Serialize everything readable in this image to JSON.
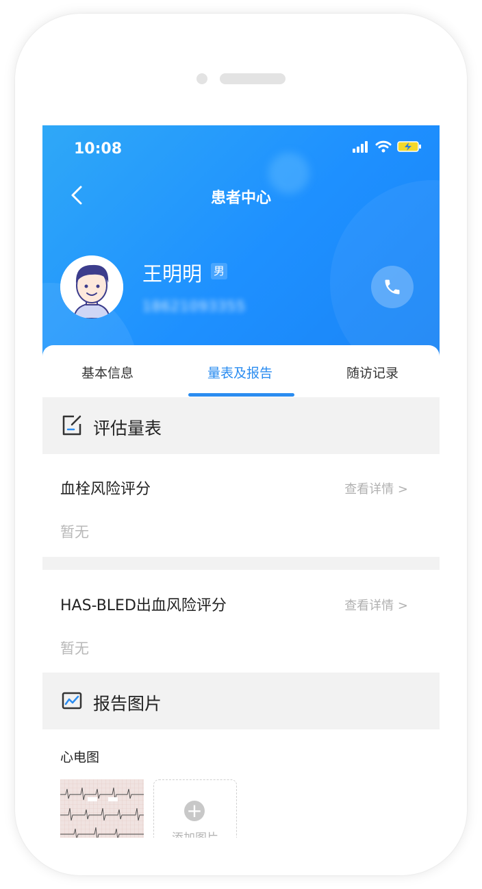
{
  "status": {
    "time": "10:08"
  },
  "header": {
    "title": "患者中心"
  },
  "patient": {
    "name": "王明明",
    "gender": "男",
    "phone": "18621093355"
  },
  "tabs": [
    {
      "label": "基本信息",
      "active": false
    },
    {
      "label": "量表及报告",
      "active": true
    },
    {
      "label": "随访记录",
      "active": false
    }
  ],
  "scales": {
    "title": "评估量表",
    "items": [
      {
        "title": "血栓风险评分",
        "link": "查看详情 >",
        "value": "暂无"
      },
      {
        "title": "HAS-BLED出血风险评分",
        "link": "查看详情 >",
        "value": "暂无"
      }
    ]
  },
  "reports": {
    "title": "报告图片",
    "ecg_label": "心电图",
    "add_label": "添加图片"
  },
  "colors": {
    "accent": "#2a8cf0",
    "header_bg": "#1e90ff"
  }
}
